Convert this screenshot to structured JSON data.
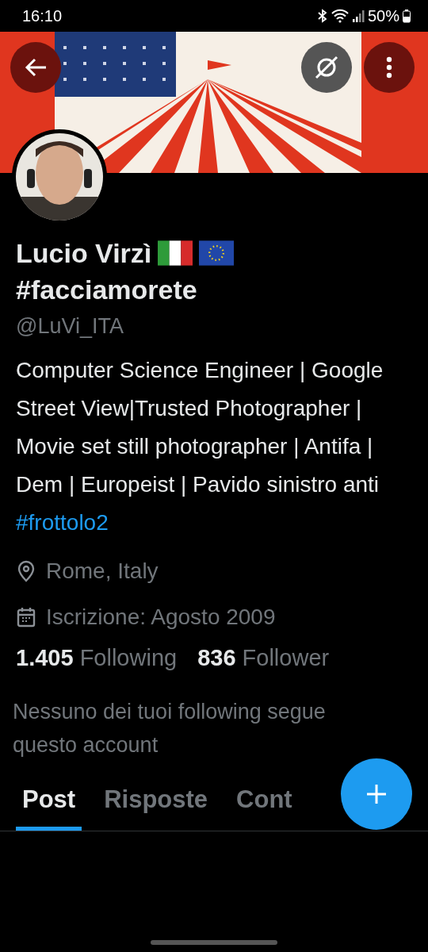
{
  "status_bar": {
    "time": "16:10",
    "battery": "50%"
  },
  "profile": {
    "name": "Lucio Virzì",
    "hashtag": "#facciamorete",
    "handle": "@LuVi_ITA",
    "bio": {
      "text": "Computer Science Engineer | Google Street View|Trusted Photographer | Movie set still photographer | Antifa | Dem | Europeist | Pavido sinistro anti",
      "link": "#frottolo2"
    },
    "location": "Rome, Italy",
    "joined": "Iscrizione: Agosto 2009",
    "stats": [
      {
        "count": "1.405",
        "label": "Following"
      },
      {
        "count": "836",
        "label": "Follower"
      }
    ],
    "followers_note": "Nessuno dei tuoi following segue questo account"
  },
  "tabs": [
    {
      "label": "Post",
      "selected": true
    },
    {
      "label": "Risposte",
      "selected": false
    },
    {
      "label": "Cont",
      "selected": false
    }
  ]
}
